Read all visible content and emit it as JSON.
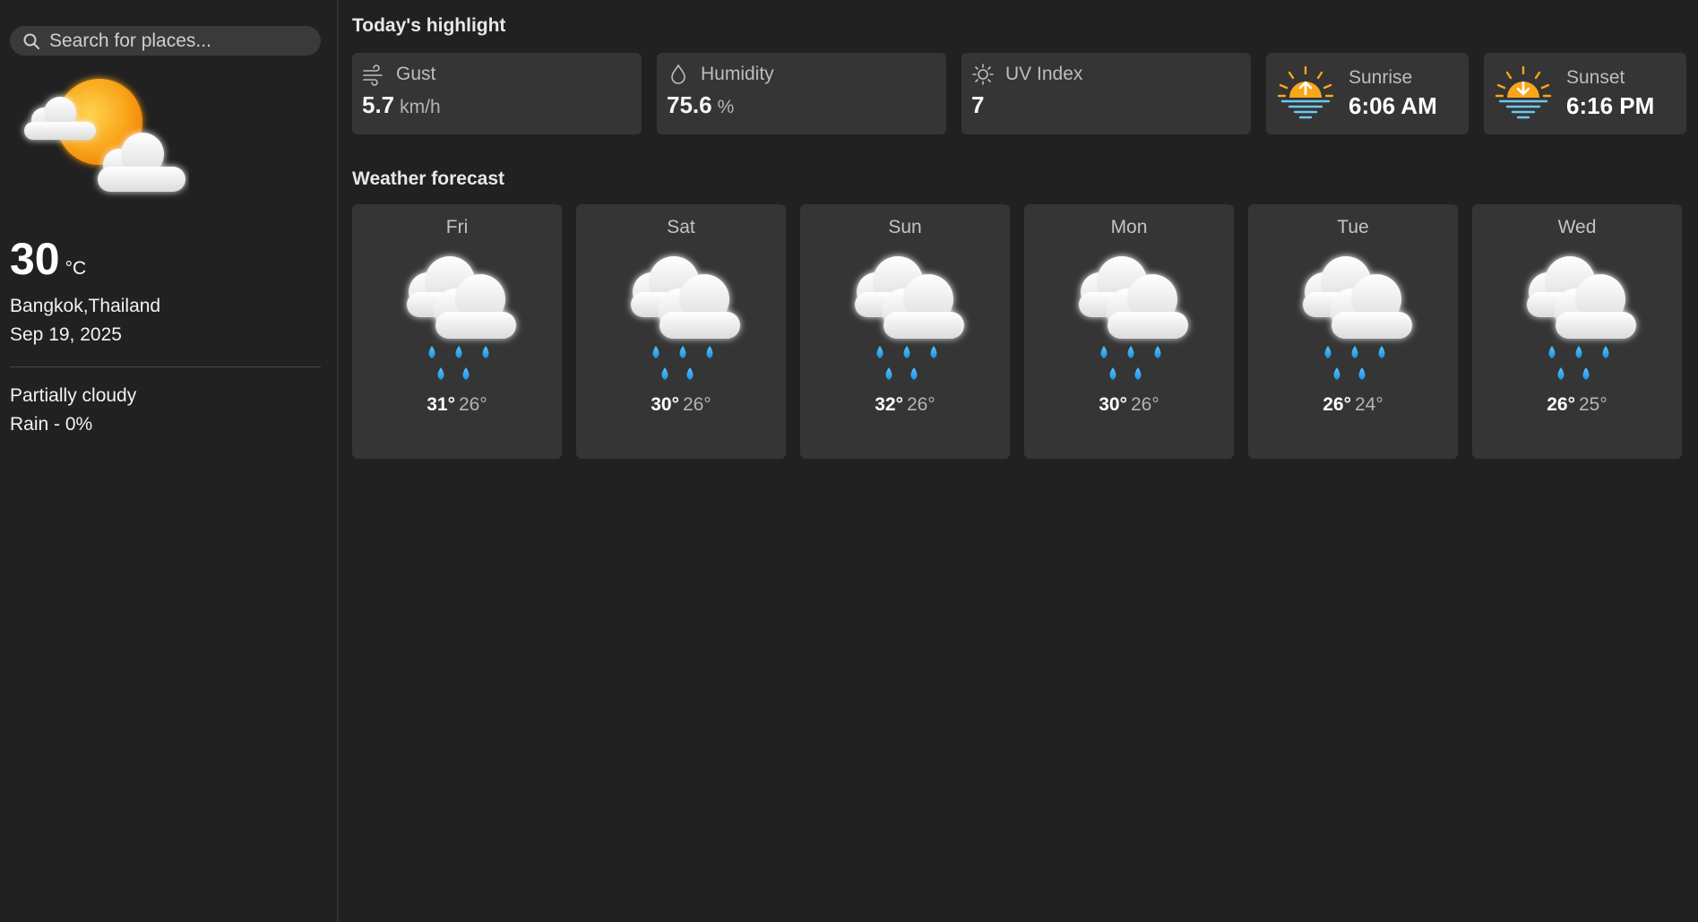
{
  "sidebar": {
    "search_placeholder": "Search for places...",
    "weather_icon": "sun-behind-clouds-icon",
    "temperature": "30",
    "temperature_unit": "°C",
    "location": "Bangkok,Thailand",
    "date": "Sep 19, 2025",
    "condition": "Partially cloudy",
    "rain": "Rain - 0%"
  },
  "highlights": {
    "title": "Today's highlight",
    "gust": {
      "label": "Gust",
      "value": "5.7",
      "unit": "km/h",
      "icon": "wind-icon"
    },
    "humidity": {
      "label": "Humidity",
      "value": "75.6",
      "unit": "%",
      "icon": "droplet-icon"
    },
    "uv": {
      "label": "UV Index",
      "value": "7",
      "icon": "sun-outline-icon"
    },
    "sunrise": {
      "label": "Sunrise",
      "time": "6:06 AM",
      "icon": "sunrise-icon"
    },
    "sunset": {
      "label": "Sunset",
      "time": "6:16 PM",
      "icon": "sunset-icon"
    }
  },
  "forecast": {
    "title": "Weather forecast",
    "days": [
      {
        "day": "Fri",
        "high": "31°",
        "low": "26°",
        "icon": "rain-cloud-icon"
      },
      {
        "day": "Sat",
        "high": "30°",
        "low": "26°",
        "icon": "rain-cloud-icon"
      },
      {
        "day": "Sun",
        "high": "32°",
        "low": "26°",
        "icon": "rain-cloud-icon"
      },
      {
        "day": "Mon",
        "high": "30°",
        "low": "26°",
        "icon": "rain-cloud-icon"
      },
      {
        "day": "Tue",
        "high": "26°",
        "low": "24°",
        "icon": "rain-cloud-icon"
      },
      {
        "day": "Wed",
        "high": "26°",
        "low": "25°",
        "icon": "rain-cloud-icon"
      }
    ]
  },
  "colors": {
    "background": "#212121",
    "card": "#353535",
    "sun": "#f9a61a",
    "rain": "#2aa9ef"
  }
}
